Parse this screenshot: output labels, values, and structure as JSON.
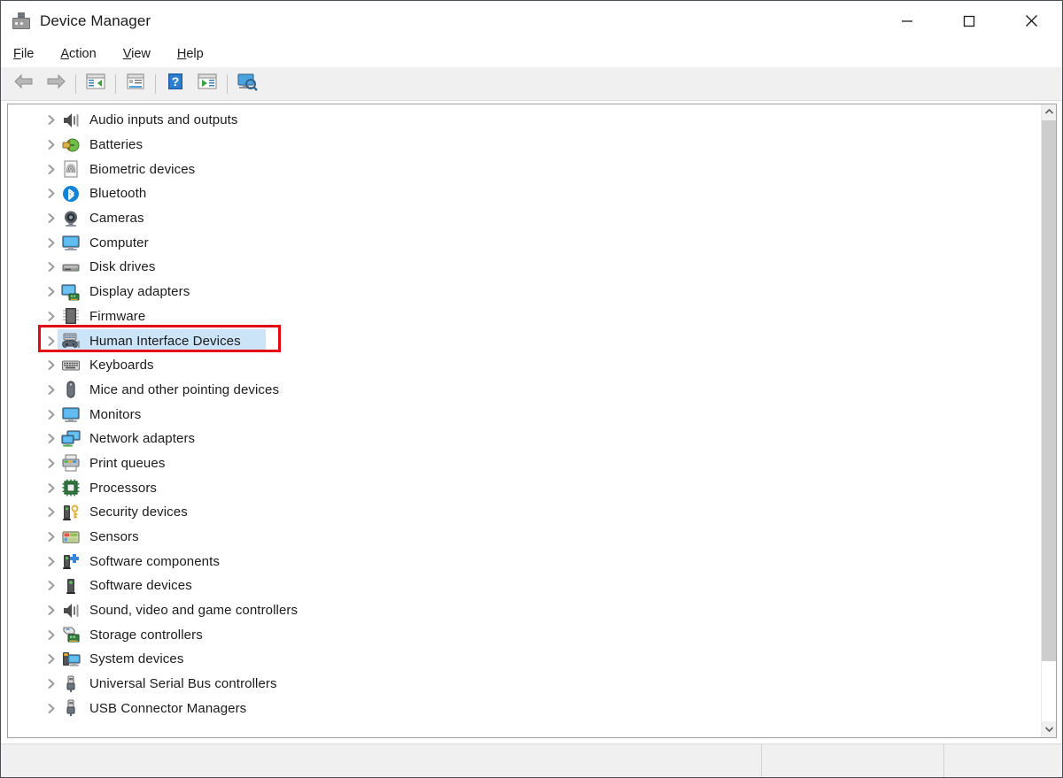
{
  "window": {
    "title": "Device Manager",
    "icon": "device-manager-icon",
    "controls": [
      {
        "name": "minimize-button",
        "glyph": "minimize"
      },
      {
        "name": "maximize-button",
        "glyph": "maximize"
      },
      {
        "name": "close-button",
        "glyph": "close"
      }
    ]
  },
  "menubar": {
    "items": [
      {
        "accel": "F",
        "rest": "ile"
      },
      {
        "accel": "A",
        "rest": "ction"
      },
      {
        "accel": "V",
        "rest": "iew"
      },
      {
        "accel": "H",
        "rest": "elp"
      }
    ]
  },
  "toolbar": {
    "buttons": [
      {
        "name": "back-button",
        "icon": "back-arrow-icon"
      },
      {
        "name": "forward-button",
        "icon": "forward-arrow-icon"
      },
      {
        "name": "separator",
        "icon": "separator"
      },
      {
        "name": "show-hide-console-tree-button",
        "icon": "console-tree-icon"
      },
      {
        "name": "separator",
        "icon": "separator"
      },
      {
        "name": "properties-button",
        "icon": "properties-icon"
      },
      {
        "name": "separator",
        "icon": "separator"
      },
      {
        "name": "help-button",
        "icon": "help-icon"
      },
      {
        "name": "update-driver-button",
        "icon": "update-driver-icon"
      },
      {
        "name": "separator",
        "icon": "separator"
      },
      {
        "name": "scan-for-hardware-changes-button",
        "icon": "scan-hardware-icon"
      }
    ]
  },
  "tree": {
    "items": [
      {
        "label": "Audio inputs and outputs",
        "icon": "speaker-icon",
        "selected": false
      },
      {
        "label": "Batteries",
        "icon": "battery-icon",
        "selected": false
      },
      {
        "label": "Biometric devices",
        "icon": "fingerprint-icon",
        "selected": false
      },
      {
        "label": "Bluetooth",
        "icon": "bluetooth-icon",
        "selected": false
      },
      {
        "label": "Cameras",
        "icon": "camera-icon",
        "selected": false
      },
      {
        "label": "Computer",
        "icon": "computer-icon",
        "selected": false
      },
      {
        "label": "Disk drives",
        "icon": "disk-drive-icon",
        "selected": false
      },
      {
        "label": "Display adapters",
        "icon": "display-adapter-icon",
        "selected": false
      },
      {
        "label": "Firmware",
        "icon": "firmware-chip-icon",
        "selected": false
      },
      {
        "label": "Human Interface Devices",
        "icon": "hid-icon",
        "selected": true
      },
      {
        "label": "Keyboards",
        "icon": "keyboard-icon",
        "selected": false
      },
      {
        "label": "Mice and other pointing devices",
        "icon": "mouse-icon",
        "selected": false
      },
      {
        "label": "Monitors",
        "icon": "monitor-icon",
        "selected": false
      },
      {
        "label": "Network adapters",
        "icon": "network-adapter-icon",
        "selected": false
      },
      {
        "label": "Print queues",
        "icon": "printer-icon",
        "selected": false
      },
      {
        "label": "Processors",
        "icon": "processor-icon",
        "selected": false
      },
      {
        "label": "Security devices",
        "icon": "security-device-icon",
        "selected": false
      },
      {
        "label": "Sensors",
        "icon": "sensor-icon",
        "selected": false
      },
      {
        "label": "Software components",
        "icon": "software-component-icon",
        "selected": false
      },
      {
        "label": "Software devices",
        "icon": "software-device-icon",
        "selected": false
      },
      {
        "label": "Sound, video and game controllers",
        "icon": "speaker-icon",
        "selected": false
      },
      {
        "label": "Storage controllers",
        "icon": "storage-controller-icon",
        "selected": false
      },
      {
        "label": "System devices",
        "icon": "system-device-icon",
        "selected": false
      },
      {
        "label": "Universal Serial Bus controllers",
        "icon": "usb-icon",
        "selected": false
      },
      {
        "label": "USB Connector Managers",
        "icon": "usb-icon",
        "selected": false
      }
    ],
    "expand_chevron": "chevron-right-icon"
  },
  "annotation": {
    "name": "red-highlight-box",
    "target_label": "Human Interface Devices",
    "color": "#e30613"
  },
  "selection": {
    "color": "#cce4f7"
  },
  "scrollbar": {
    "up_arrow": "chevron-up-icon",
    "down_arrow": "chevron-down-icon",
    "thumb_color": "#cdcdcd"
  },
  "statusbar": {
    "panes": [
      "",
      "",
      ""
    ]
  }
}
